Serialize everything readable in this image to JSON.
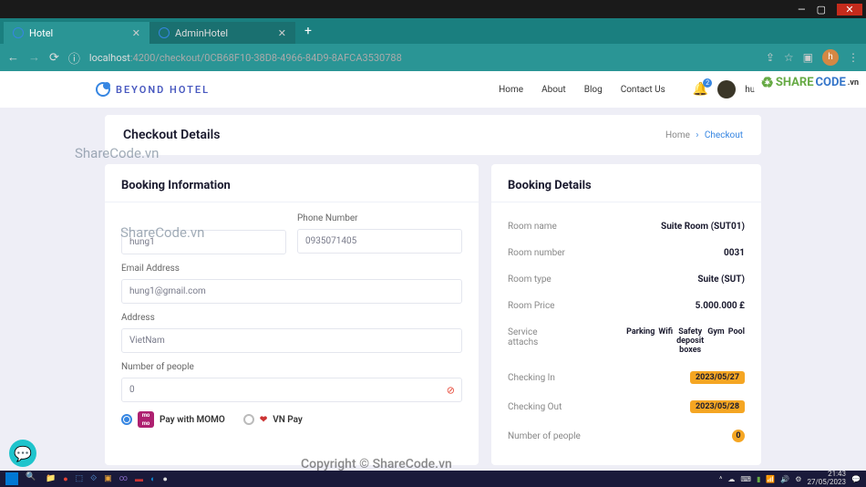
{
  "window": {
    "tabs": [
      {
        "title": "Hotel",
        "active": true
      },
      {
        "title": "AdminHotel",
        "active": false
      }
    ],
    "url_host": "localhost",
    "url_port": ":4200",
    "url_path": "/checkout/0CB68F10-38D8-4966-84D9-8AFCA3530788",
    "profile_letter": "h"
  },
  "brand": {
    "logo_text": "BEYOND HOTEL"
  },
  "nav": {
    "items": [
      "Home",
      "About",
      "Blog",
      "Contact Us"
    ],
    "notif_count": "2",
    "username": "hung1"
  },
  "breadcrumb": {
    "title": "Checkout Details",
    "home": "Home",
    "sep": "›",
    "current": "Checkout"
  },
  "form": {
    "title": "Booking Information",
    "name_value": "hung1",
    "phone_label": "Phone Number",
    "phone_value": "0935071405",
    "email_label": "Email Address",
    "email_value": "hung1@gmail.com",
    "address_label": "Address",
    "address_value": "VietNam",
    "people_label": "Number of people",
    "people_value": "0",
    "pay_momo": "Pay with MOMO",
    "pay_vnpay": "VN Pay"
  },
  "details": {
    "title": "Booking Details",
    "room_name_label": "Room name",
    "room_name": "Suite Room (SUT01)",
    "room_number_label": "Room number",
    "room_number": "0031",
    "room_type_label": "Room type",
    "room_type": "Suite (SUT)",
    "room_price_label": "Room Price",
    "room_price": "5.000.000 £",
    "service_label": "Service attachs",
    "services": {
      "s1": "Parking",
      "s2": "Wifi",
      "s3a": "Safety",
      "s3b": "deposit",
      "s3c": "boxes",
      "s4": "Gym",
      "s5": "Pool"
    },
    "checkin_label": "Checking In",
    "checkin": "2023/05/27",
    "checkout_label": "Checking Out",
    "checkout": "2023/05/28",
    "people_label": "Number of people",
    "people": "0"
  },
  "watermarks": {
    "wm": "ShareCode.vn",
    "wm3": "Copyright © ShareCode.vn",
    "logo1": "SHARE",
    "logo2": "CODE",
    "logo3": ".vn"
  },
  "taskbar": {
    "time": "21:43",
    "date": "27/05/2023"
  }
}
